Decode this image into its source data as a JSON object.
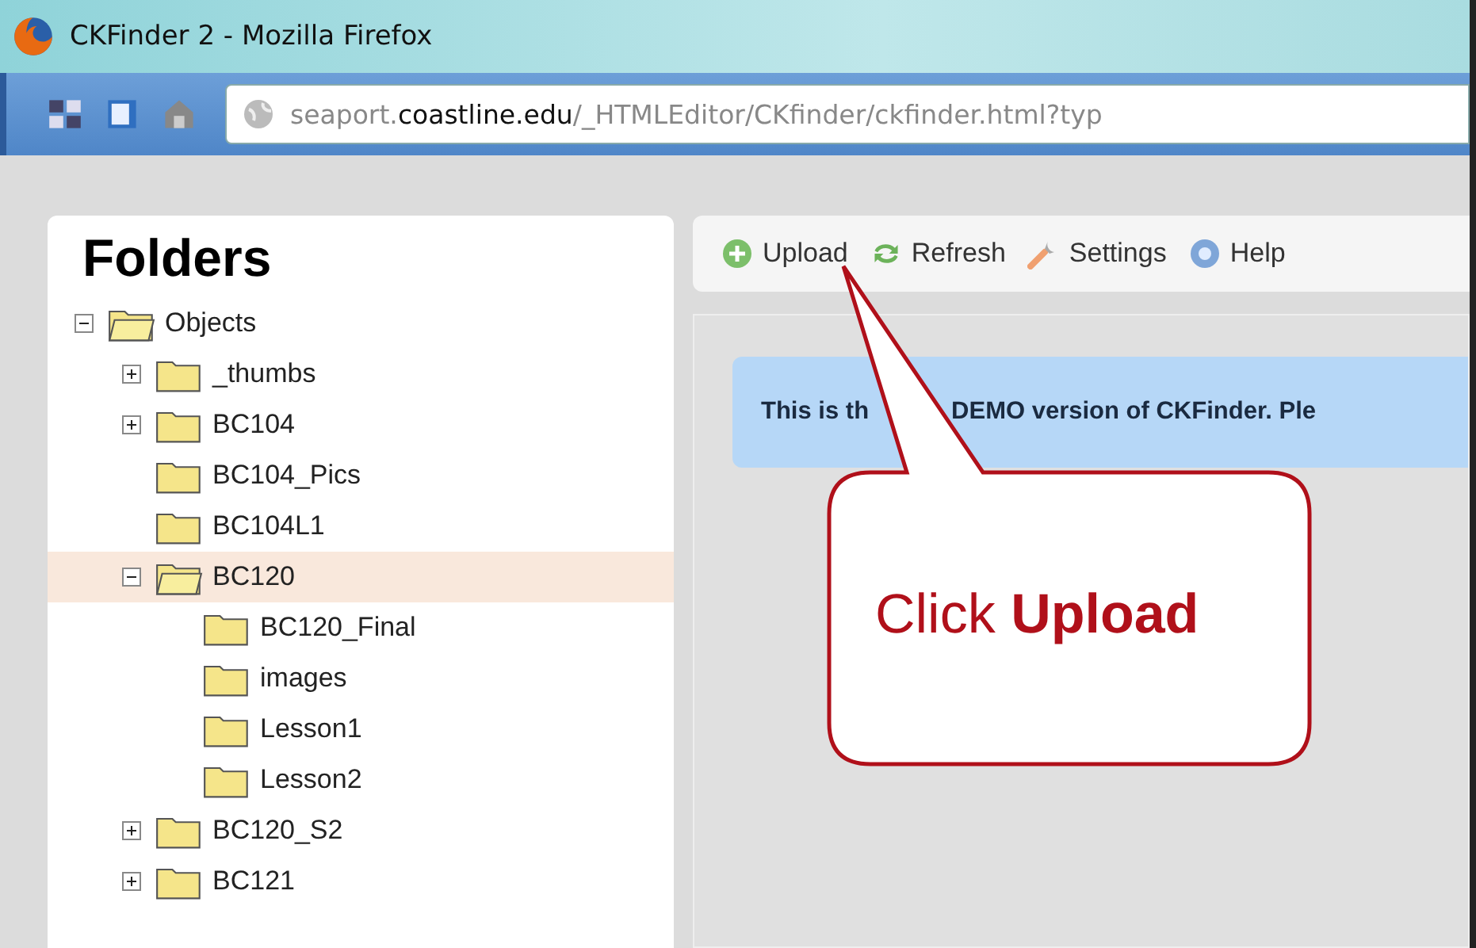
{
  "window": {
    "title": "CKFinder 2 - Mozilla Firefox"
  },
  "address_bar": {
    "value": "seaport.**coastline.edu**/_HTMLEditor/CKfinder/ckfinder.html?typ"
  },
  "folders": {
    "title": "Folders",
    "tree": [
      {
        "label": "Objects",
        "expanded": true,
        "selected": false,
        "children": [
          {
            "label": "_thumbs",
            "expanded": false,
            "selected": false
          },
          {
            "label": "BC104",
            "expanded": false,
            "selected": false
          },
          {
            "label": "BC104_Pics",
            "selected": false
          },
          {
            "label": "BC104L1",
            "selected": false
          },
          {
            "label": "BC120",
            "expanded": true,
            "selected": true,
            "children": [
              {
                "label": "BC120_Final",
                "selected": false
              },
              {
                "label": "images",
                "selected": false
              },
              {
                "label": "Lesson1",
                "selected": false
              },
              {
                "label": "Lesson2",
                "selected": false
              }
            ]
          },
          {
            "label": "BC120_S2",
            "expanded": false,
            "selected": false
          },
          {
            "label": "BC121",
            "expanded": false,
            "selected": false
          }
        ]
      }
    ]
  },
  "toolbar": [
    {
      "label": "Upload",
      "kind": "upload"
    },
    {
      "label": "Refresh",
      "kind": "refresh"
    },
    {
      "label": "Settings",
      "kind": "settings"
    },
    {
      "label": "Help",
      "kind": "help"
    }
  ],
  "banner": {
    "parts": [
      "This is th",
      "DEMO version of CKFinder. Ple"
    ]
  },
  "callout": {
    "text": "Click **Upload**"
  }
}
